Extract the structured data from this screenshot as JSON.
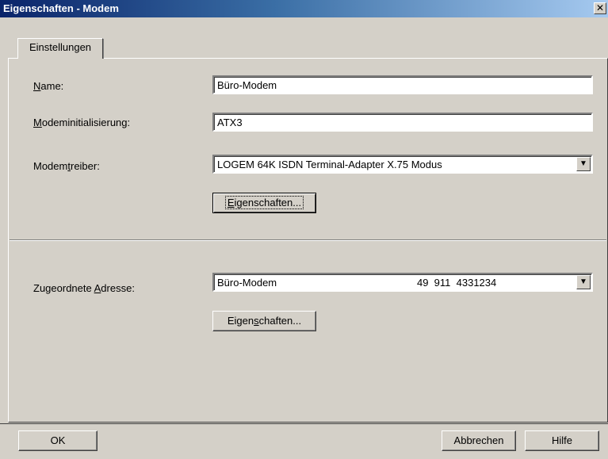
{
  "window": {
    "title": "Eigenschaften - Modem",
    "close_glyph": "✕"
  },
  "tabs": [
    {
      "label": "Einstellungen"
    }
  ],
  "form": {
    "name": {
      "label": "Name:",
      "value": "Büro-Modem"
    },
    "init": {
      "label": "Modeminitialisierung:",
      "value": "ATX3"
    },
    "driver": {
      "label": "Modemtreiber:",
      "value": "LOGEM 64K ISDN Terminal-Adapter X.75 Modus"
    },
    "driver_props_button": "Eigenschaften...",
    "address": {
      "label": "Zugeordnete Adresse:",
      "value_name": "Büro-Modem",
      "value_number": "49  911  4331234"
    },
    "address_props_button": "Eigenschaften..."
  },
  "buttons": {
    "ok": "OK",
    "cancel": "Abbrechen",
    "help": "Hilfe"
  },
  "icons": {
    "dropdown": "dropdown-arrow-icon",
    "close": "close-icon"
  }
}
